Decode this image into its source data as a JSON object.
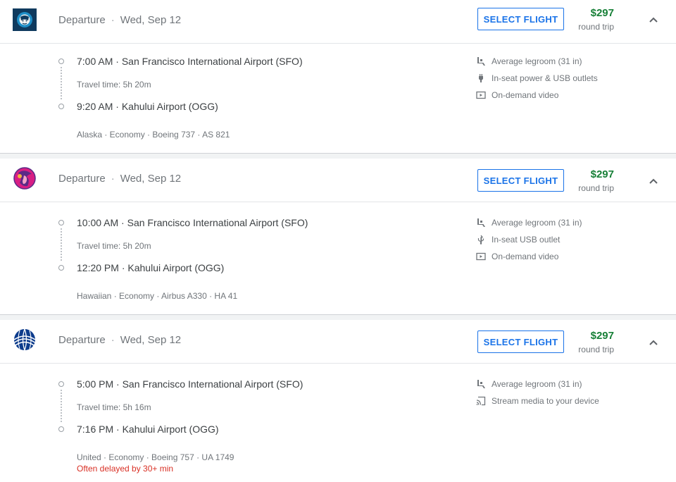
{
  "flights": [
    {
      "airline_logo": "alaska-airlines-logo",
      "departure_label": "Departure",
      "date": "Wed, Sep 12",
      "select_label": "SELECT FLIGHT",
      "price": "$297",
      "price_note": "round trip",
      "depart_time": "7:00 AM",
      "depart_airport": "San Francisco International Airport (SFO)",
      "travel_time": "Travel time: 5h 20m",
      "arrive_time": "9:20 AM",
      "arrive_airport": "Kahului Airport (OGG)",
      "details": "Alaska · Economy · Boeing 737 · AS 821",
      "amenities": [
        {
          "icon": "legroom-icon",
          "text": "Average legroom (31 in)"
        },
        {
          "icon": "power-plug-icon",
          "text": "In-seat power & USB outlets"
        },
        {
          "icon": "video-icon",
          "text": "On-demand video"
        }
      ]
    },
    {
      "airline_logo": "hawaiian-airlines-logo",
      "departure_label": "Departure",
      "date": "Wed, Sep 12",
      "select_label": "SELECT FLIGHT",
      "price": "$297",
      "price_note": "round trip",
      "depart_time": "10:00 AM",
      "depart_airport": "San Francisco International Airport (SFO)",
      "travel_time": "Travel time: 5h 20m",
      "arrive_time": "12:20 PM",
      "arrive_airport": "Kahului Airport (OGG)",
      "details": "Hawaiian · Economy · Airbus A330 · HA 41",
      "amenities": [
        {
          "icon": "legroom-icon",
          "text": "Average legroom (31 in)"
        },
        {
          "icon": "usb-icon",
          "text": "In-seat USB outlet"
        },
        {
          "icon": "video-icon",
          "text": "On-demand video"
        }
      ]
    },
    {
      "airline_logo": "united-airlines-logo",
      "departure_label": "Departure",
      "date": "Wed, Sep 12",
      "select_label": "SELECT FLIGHT",
      "price": "$297",
      "price_note": "round trip",
      "depart_time": "5:00 PM",
      "depart_airport": "San Francisco International Airport (SFO)",
      "travel_time": "Travel time: 5h 16m",
      "arrive_time": "7:16 PM",
      "arrive_airport": "Kahului Airport (OGG)",
      "details": "United · Economy · Boeing 757 · UA 1749",
      "delay_note": "Often delayed by 30+ min",
      "amenities": [
        {
          "icon": "legroom-icon",
          "text": "Average legroom (31 in)"
        },
        {
          "icon": "cast-icon",
          "text": "Stream media to your device"
        }
      ]
    }
  ],
  "separator": "·",
  "colors": {
    "accent": "#1a73e8",
    "price": "#188038",
    "delay": "#d93025",
    "alaska": "#0f3a5e",
    "hawaiian_bg": "#d81e84",
    "united": "#0c3b8c"
  }
}
